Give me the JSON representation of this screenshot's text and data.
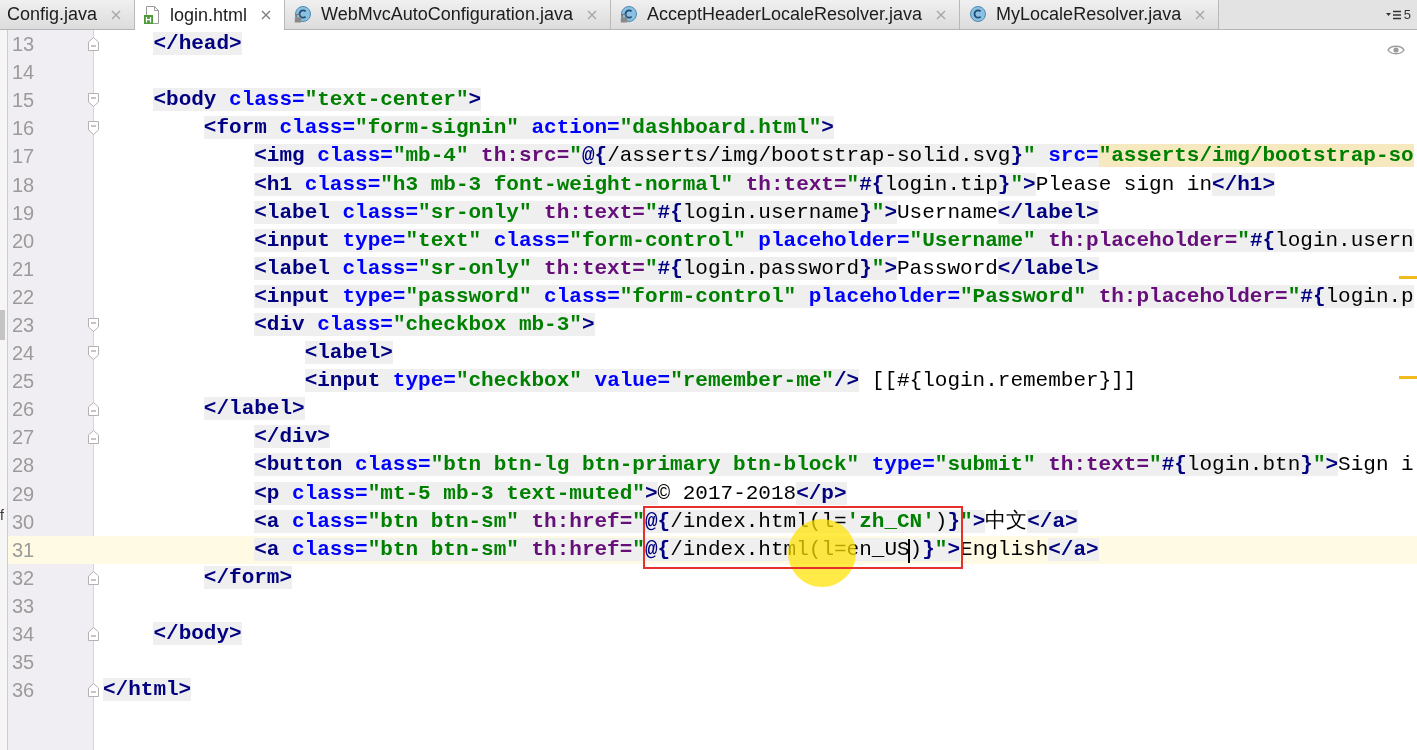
{
  "tabs": [
    {
      "label": "Config.java",
      "kind": "plain",
      "selected": false
    },
    {
      "label": "login.html",
      "kind": "html",
      "selected": true
    },
    {
      "label": "WebMvcAutoConfiguration.java",
      "kind": "class-locked",
      "selected": false
    },
    {
      "label": "AcceptHeaderLocaleResolver.java",
      "kind": "class-locked",
      "selected": false
    },
    {
      "label": "MyLocaleResolver.java",
      "kind": "class",
      "selected": false
    }
  ],
  "tab_overflow": {
    "count": "5"
  },
  "side_panel": {
    "text": "f"
  },
  "editor": {
    "lines": [
      {
        "number": "13",
        "kind": "fold-end",
        "current": false,
        "tokens": [
          {
            "kind": "tag",
            "text": "    </head>"
          }
        ]
      },
      {
        "number": "14",
        "kind": "plain",
        "current": false
      },
      {
        "number": "15",
        "kind": "fold-start",
        "current": false,
        "tokens": [
          {
            "kind": "tag",
            "text": "    <body"
          },
          {
            "kind": "attr",
            "text": " class="
          },
          {
            "kind": "val",
            "text": "\"text-center\""
          },
          {
            "kind": "tag",
            "text": ">"
          }
        ]
      },
      {
        "number": "16",
        "kind": "fold-start",
        "current": false,
        "tokens": [
          {
            "kind": "tag",
            "text": "        <form"
          },
          {
            "kind": "attr",
            "text": " class="
          },
          {
            "kind": "val",
            "text": "\"form-signin\""
          },
          {
            "kind": "attr",
            "text": " action="
          },
          {
            "kind": "val",
            "text": "\"dashboard.html\""
          },
          {
            "kind": "tag",
            "text": ">"
          }
        ]
      },
      {
        "number": "17",
        "kind": "plain",
        "current": false,
        "tokens": [
          {
            "kind": "tag",
            "text": "            <img"
          },
          {
            "kind": "attr",
            "text": " class="
          },
          {
            "kind": "val",
            "text": "\"mb-4\""
          },
          {
            "kind": "th",
            "text": " th:src="
          },
          {
            "kind": "val",
            "text": "\""
          },
          {
            "kind": "expr",
            "text": "@{"
          },
          {
            "kind": "expr-body",
            "text": "/asserts/img/bootstrap-solid.svg"
          },
          {
            "kind": "expr",
            "text": "}"
          },
          {
            "kind": "val",
            "text": "\""
          },
          {
            "kind": "attr",
            "text": " src="
          },
          {
            "kind": "warn",
            "text": "\"asserts/img/bootstrap-so"
          }
        ]
      },
      {
        "number": "18",
        "kind": "plain",
        "current": false,
        "tokens": [
          {
            "kind": "tag",
            "text": "            <h1"
          },
          {
            "kind": "attr",
            "text": " class="
          },
          {
            "kind": "val",
            "text": "\"h3 mb-3 font-weight-normal\""
          },
          {
            "kind": "th",
            "text": " th:text="
          },
          {
            "kind": "val",
            "text": "\""
          },
          {
            "kind": "expr",
            "text": "#{"
          },
          {
            "kind": "expr-body",
            "text": "login.tip"
          },
          {
            "kind": "expr",
            "text": "}"
          },
          {
            "kind": "val",
            "text": "\""
          },
          {
            "kind": "tag",
            "text": ">"
          },
          {
            "kind": "text",
            "text": "Please sign in"
          },
          {
            "kind": "tag",
            "text": "</h1>"
          }
        ]
      },
      {
        "number": "19",
        "kind": "plain",
        "current": false,
        "tokens": [
          {
            "kind": "tag",
            "text": "            <label"
          },
          {
            "kind": "attr",
            "text": " class="
          },
          {
            "kind": "val",
            "text": "\"sr-only\""
          },
          {
            "kind": "th",
            "text": " th:text="
          },
          {
            "kind": "val",
            "text": "\""
          },
          {
            "kind": "expr",
            "text": "#{"
          },
          {
            "kind": "expr-body",
            "text": "login.username"
          },
          {
            "kind": "expr",
            "text": "}"
          },
          {
            "kind": "val",
            "text": "\""
          },
          {
            "kind": "tag",
            "text": ">"
          },
          {
            "kind": "text",
            "text": "Username"
          },
          {
            "kind": "tag",
            "text": "</label>"
          }
        ]
      },
      {
        "number": "20",
        "kind": "plain",
        "current": false,
        "tokens": [
          {
            "kind": "tag",
            "text": "            <input"
          },
          {
            "kind": "attr",
            "text": " type="
          },
          {
            "kind": "val",
            "text": "\"text\""
          },
          {
            "kind": "attr",
            "text": " class="
          },
          {
            "kind": "val",
            "text": "\"form-control\""
          },
          {
            "kind": "attr",
            "text": " placeholder="
          },
          {
            "kind": "val",
            "text": "\"Username\""
          },
          {
            "kind": "th",
            "text": " th:placeholder="
          },
          {
            "kind": "val",
            "text": "\""
          },
          {
            "kind": "expr",
            "text": "#{"
          },
          {
            "kind": "expr-body",
            "text": "login.usern"
          }
        ]
      },
      {
        "number": "21",
        "kind": "plain",
        "current": false,
        "tokens": [
          {
            "kind": "tag",
            "text": "            <label"
          },
          {
            "kind": "attr",
            "text": " class="
          },
          {
            "kind": "val",
            "text": "\"sr-only\""
          },
          {
            "kind": "th",
            "text": " th:text="
          },
          {
            "kind": "val",
            "text": "\""
          },
          {
            "kind": "expr",
            "text": "#{"
          },
          {
            "kind": "expr-body",
            "text": "login.password"
          },
          {
            "kind": "expr",
            "text": "}"
          },
          {
            "kind": "val",
            "text": "\""
          },
          {
            "kind": "tag",
            "text": ">"
          },
          {
            "kind": "text",
            "text": "Password"
          },
          {
            "kind": "tag",
            "text": "</label>"
          }
        ]
      },
      {
        "number": "22",
        "kind": "plain",
        "current": false,
        "tokens": [
          {
            "kind": "tag",
            "text": "            <input"
          },
          {
            "kind": "attr",
            "text": " type="
          },
          {
            "kind": "val",
            "text": "\"password\""
          },
          {
            "kind": "attr",
            "text": " class="
          },
          {
            "kind": "val",
            "text": "\"form-control\""
          },
          {
            "kind": "attr",
            "text": " placeholder="
          },
          {
            "kind": "val",
            "text": "\"Password\""
          },
          {
            "kind": "th",
            "text": " th:placeholder="
          },
          {
            "kind": "val",
            "text": "\""
          },
          {
            "kind": "expr",
            "text": "#{"
          },
          {
            "kind": "expr-body",
            "text": "login.p"
          }
        ]
      },
      {
        "number": "23",
        "kind": "fold-start",
        "current": false,
        "tokens": [
          {
            "kind": "tag",
            "text": "            <div"
          },
          {
            "kind": "attr",
            "text": " class="
          },
          {
            "kind": "val",
            "text": "\"checkbox mb-3\""
          },
          {
            "kind": "tag",
            "text": ">"
          }
        ]
      },
      {
        "number": "24",
        "kind": "fold-start",
        "current": false,
        "tokens": [
          {
            "kind": "tag",
            "text": "                <label>"
          }
        ]
      },
      {
        "number": "25",
        "kind": "plain",
        "current": false,
        "tokens": [
          {
            "kind": "tag",
            "text": "                <input"
          },
          {
            "kind": "attr",
            "text": " type="
          },
          {
            "kind": "val",
            "text": "\"checkbox\""
          },
          {
            "kind": "attr",
            "text": " value="
          },
          {
            "kind": "val",
            "text": "\"remember-me\""
          },
          {
            "kind": "tag",
            "text": "/>"
          },
          {
            "kind": "text",
            "text": " [[#{login.remember}]]"
          }
        ]
      },
      {
        "number": "26",
        "kind": "fold-end",
        "current": false,
        "tokens": [
          {
            "kind": "tag",
            "text": "        </label>"
          }
        ]
      },
      {
        "number": "27",
        "kind": "fold-end",
        "current": false,
        "tokens": [
          {
            "kind": "tag",
            "text": "            </div>"
          }
        ]
      },
      {
        "number": "28",
        "kind": "plain",
        "current": false,
        "tokens": [
          {
            "kind": "tag",
            "text": "            <button"
          },
          {
            "kind": "attr",
            "text": " class="
          },
          {
            "kind": "val",
            "text": "\"btn btn-lg btn-primary btn-block\""
          },
          {
            "kind": "attr",
            "text": " type="
          },
          {
            "kind": "val",
            "text": "\"submit\""
          },
          {
            "kind": "th",
            "text": " th:text="
          },
          {
            "kind": "val",
            "text": "\""
          },
          {
            "kind": "expr",
            "text": "#{"
          },
          {
            "kind": "expr-body",
            "text": "login.btn"
          },
          {
            "kind": "expr",
            "text": "}"
          },
          {
            "kind": "val",
            "text": "\""
          },
          {
            "kind": "tag",
            "text": ">"
          },
          {
            "kind": "text",
            "text": "Sign i"
          }
        ]
      },
      {
        "number": "29",
        "kind": "plain",
        "current": false,
        "tokens": [
          {
            "kind": "tag",
            "text": "            <p"
          },
          {
            "kind": "attr",
            "text": " class="
          },
          {
            "kind": "val",
            "text": "\"mt-5 mb-3 text-muted\""
          },
          {
            "kind": "tag",
            "text": ">"
          },
          {
            "kind": "text",
            "text": "© 2017-2018"
          },
          {
            "kind": "tag",
            "text": "</p>"
          }
        ]
      },
      {
        "number": "30",
        "kind": "plain",
        "current": false,
        "tokens": [
          {
            "kind": "tag",
            "text": "            <a"
          },
          {
            "kind": "attr",
            "text": " class="
          },
          {
            "kind": "val",
            "text": "\"btn btn-sm\""
          },
          {
            "kind": "th",
            "text": " th:href="
          },
          {
            "kind": "val",
            "text": "\""
          },
          {
            "kind": "expr",
            "text": "@{"
          },
          {
            "kind": "expr-body",
            "text": "/index.html(l="
          },
          {
            "kind": "val",
            "text": "'zh_CN'"
          },
          {
            "kind": "expr-body",
            "text": ")"
          },
          {
            "kind": "expr",
            "text": "}"
          },
          {
            "kind": "val",
            "text": "\""
          },
          {
            "kind": "tag",
            "text": ">"
          },
          {
            "kind": "text",
            "text": "中文"
          },
          {
            "kind": "tag",
            "text": "</a>"
          }
        ]
      },
      {
        "number": "31",
        "kind": "plain",
        "current": true,
        "tokens": [
          {
            "kind": "tag",
            "text": "            <a"
          },
          {
            "kind": "attr",
            "text": " class="
          },
          {
            "kind": "val",
            "text": "\"btn btn-sm\""
          },
          {
            "kind": "th",
            "text": " th:href="
          },
          {
            "kind": "val",
            "text": "\""
          },
          {
            "kind": "expr",
            "text": "@{"
          },
          {
            "kind": "expr-body",
            "text": "/index.html(l=en_US)"
          },
          {
            "kind": "expr",
            "text": "}"
          },
          {
            "kind": "val",
            "text": "\""
          },
          {
            "kind": "tag",
            "text": ">"
          },
          {
            "kind": "text",
            "text": "English"
          },
          {
            "kind": "tag",
            "text": "</a>"
          }
        ]
      },
      {
        "number": "32",
        "kind": "fold-end",
        "current": false,
        "tokens": [
          {
            "kind": "tag",
            "text": "        </form>"
          }
        ]
      },
      {
        "number": "33",
        "kind": "plain",
        "current": false
      },
      {
        "number": "34",
        "kind": "fold-end",
        "current": false,
        "tokens": [
          {
            "kind": "tag",
            "text": "    </body>"
          }
        ]
      },
      {
        "number": "35",
        "kind": "plain",
        "current": false
      },
      {
        "number": "36",
        "kind": "fold-end",
        "current": false,
        "tokens": [
          {
            "kind": "tag",
            "text": "</html>"
          }
        ]
      }
    ]
  }
}
